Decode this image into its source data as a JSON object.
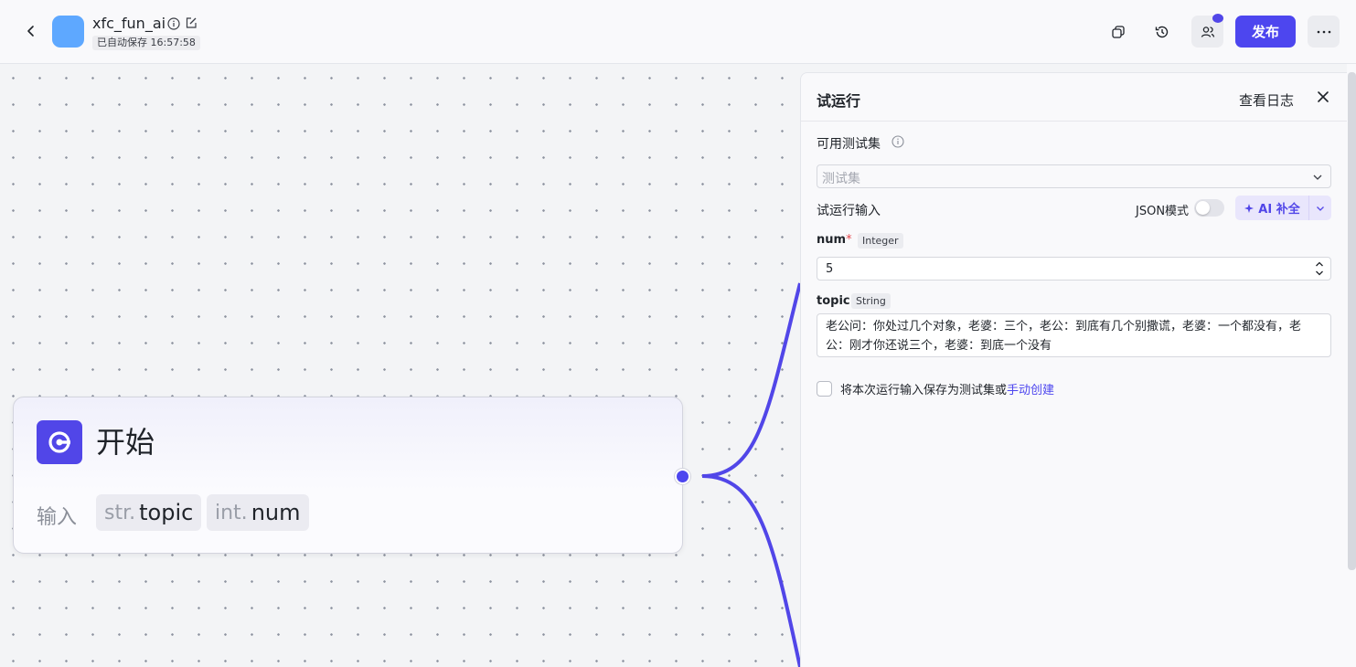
{
  "header": {
    "app_name": "xfc_fun_ai",
    "autosave": "已自动保存 16:57:58",
    "publish_label": "发布"
  },
  "canvas": {
    "start_node": {
      "title": "开始",
      "input_label": "输入",
      "inputs": [
        {
          "type": "str.",
          "name": "topic"
        },
        {
          "type": "int.",
          "name": "num"
        }
      ]
    },
    "edge_color": "#5146e8"
  },
  "panel": {
    "title": "试运行",
    "view_log": "查看日志",
    "testset_label": "可用测试集",
    "testset_placeholder": "测试集",
    "run_input_label": "试运行输入",
    "json_mode_label": "JSON模式",
    "json_mode_on": false,
    "ai_complete_label": "AI 补全",
    "fields": {
      "num": {
        "name": "num",
        "required_mark": "*",
        "type": "Integer",
        "value": "5"
      },
      "topic": {
        "name": "topic",
        "type": "String",
        "value": "老公问：你处过几个对象，老婆：三个，老公：到底有几个别撒谎，老婆：一个都没有，老公：刚才你还说三个，老婆：到底一个没有"
      }
    },
    "save_text": "将本次运行输入保存为测试集或",
    "manual_create": "手动创建"
  },
  "colors": {
    "accent": "#4d46ef",
    "app_icon": "#5ea8ff"
  }
}
